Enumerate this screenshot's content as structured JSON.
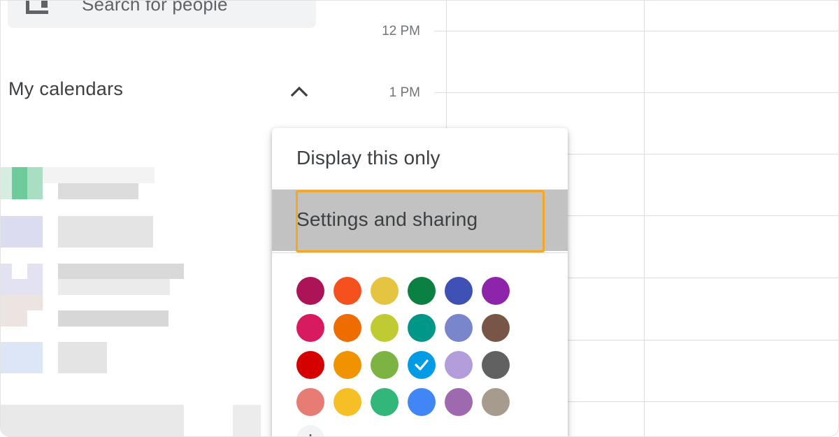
{
  "search": {
    "placeholder": "Search for people",
    "icon": "people-search-icon"
  },
  "sidebar": {
    "section_title": "My calendars",
    "collapse_icon": "chevron-up-icon"
  },
  "timeline": {
    "labels": [
      "12 PM",
      "1 PM"
    ]
  },
  "menu": {
    "items": [
      {
        "label": "Display this only"
      },
      {
        "label": "Settings and sharing",
        "selected": true
      }
    ],
    "colors": [
      [
        "#ad1457",
        "#f4511e",
        "#e4c441",
        "#0b8043",
        "#3f51b5",
        "#8e24aa"
      ],
      [
        "#d81b60",
        "#ef6c00",
        "#c0ca33",
        "#009688",
        "#7986cb",
        "#795548"
      ],
      [
        "#d50000",
        "#f09300",
        "#7cb342",
        "#039be5",
        "#b39ddb",
        "#616161"
      ],
      [
        "#e67c73",
        "#f6bf26",
        "#33b679",
        "#4285f4",
        "#9e69af",
        "#a79b8e"
      ]
    ],
    "selected_color": "#039be5",
    "add_color_icon": "plus-icon"
  },
  "accent": "#f5a623"
}
